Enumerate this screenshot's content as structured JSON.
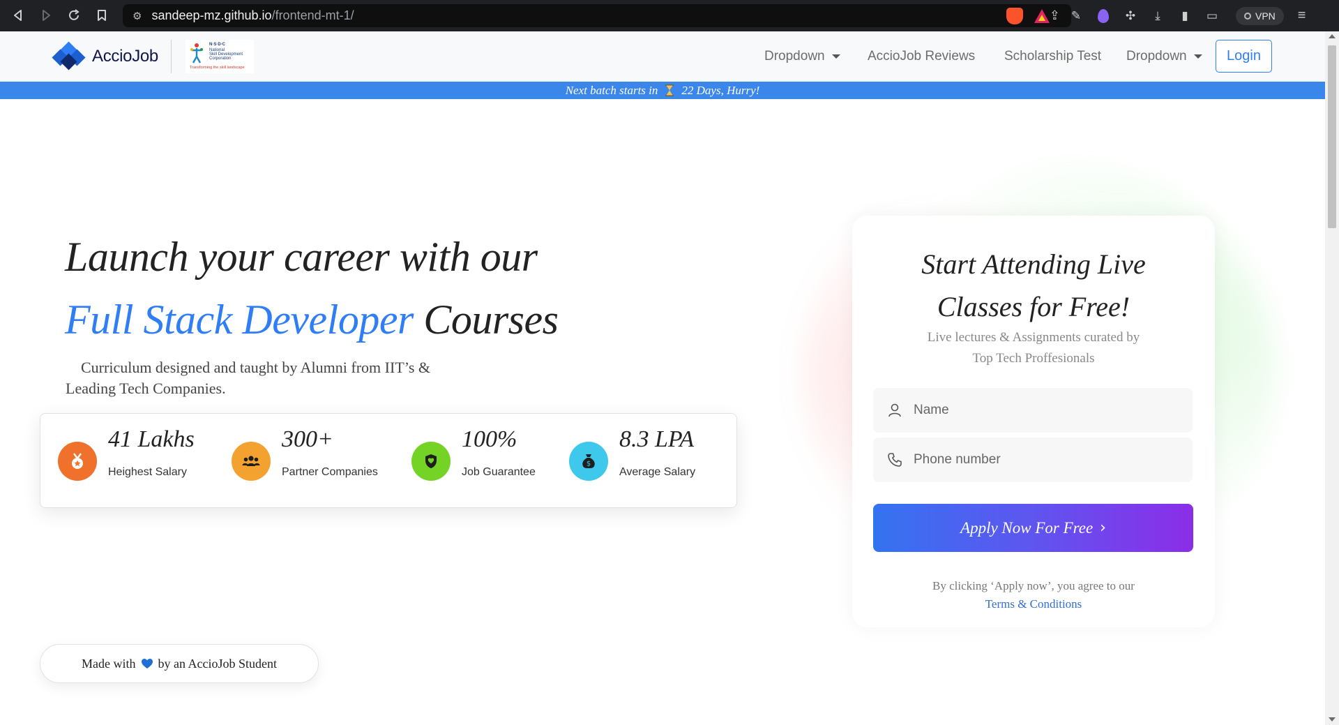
{
  "browser": {
    "url_host": "sandeep-mz.github.io",
    "url_path": "/frontend-mt-1/",
    "vpn_label": "VPN"
  },
  "navbar": {
    "brand": "AccioJob",
    "partner_logo_text": [
      "N·S·D·C",
      "National",
      "Skill Development",
      "Corporation",
      "Transforming the skill landscape"
    ],
    "items": [
      {
        "label": "Dropdown",
        "has_caret": true
      },
      {
        "label": "AccioJob Reviews",
        "has_caret": false
      },
      {
        "label": "Scholarship Test",
        "has_caret": false
      },
      {
        "label": "Dropdown",
        "has_caret": true
      }
    ],
    "login_label": "Login"
  },
  "banner": {
    "prefix": "Next batch starts in",
    "icon": "hourglass",
    "suffix": "22 Days, Hurry!"
  },
  "hero": {
    "title_line1": "Launch your career with our",
    "title_accent": "Full Stack Developer",
    "title_rest": "Courses",
    "subtitle": "Curriculum designed and taught by Alumni from IIT’s & Leading Tech Companies.",
    "accent_color": "#2f7ef5"
  },
  "stats": [
    {
      "value": "41 Lakhs",
      "label": "Heighest Salary",
      "icon": "medal-icon",
      "color": "#f0712c"
    },
    {
      "value": "300+",
      "label": "Partner Companies",
      "icon": "people-icon",
      "color": "#f3a22f"
    },
    {
      "value": "100%",
      "label": "Job Guarantee",
      "icon": "shield-icon",
      "color": "#74d324"
    },
    {
      "value": "8.3 LPA",
      "label": "Average Salary",
      "icon": "money-bag-icon",
      "color": "#3ec8ec"
    }
  ],
  "made_with": {
    "prefix": "Made with",
    "suffix": "by an AccioJob Student",
    "heart_color": "#1f6fd6"
  },
  "form": {
    "title": "Start Attending Live Classes for Free!",
    "subtitle": "Live lectures & Assignments curated by Top Tech Proffesionals",
    "name_placeholder": "Name",
    "phone_placeholder": "Phone number",
    "apply_label": "Apply Now For Free",
    "terms_prefix": "By clicking ‘Apply now’, you agree to our",
    "terms_link": "Terms & Conditions"
  }
}
